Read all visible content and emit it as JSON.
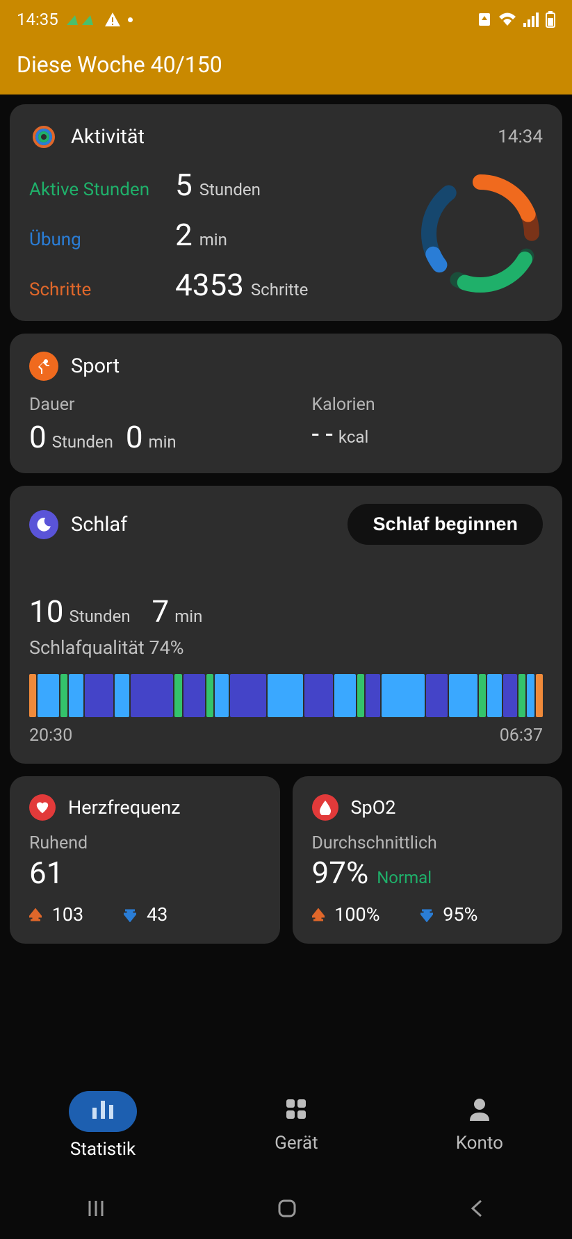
{
  "status": {
    "time": "14:35"
  },
  "header": {
    "title": "Diese Woche 40/150"
  },
  "activity": {
    "title": "Aktivität",
    "timestamp": "14:34",
    "active_hours": {
      "label": "Aktive Stunden",
      "value": "5",
      "unit": "Stunden"
    },
    "exercise": {
      "label": "Übung",
      "value": "2",
      "unit": "min"
    },
    "steps": {
      "label": "Schritte",
      "value": "4353",
      "unit": "Schritte"
    }
  },
  "sport": {
    "title": "Sport",
    "dauer_label": "Dauer",
    "dauer_h": "0",
    "dauer_h_unit": "Stunden",
    "dauer_m": "0",
    "dauer_m_unit": "min",
    "kalorien_label": "Kalorien",
    "kcal_value": "- -",
    "kcal_unit": "kcal"
  },
  "sleep": {
    "title": "Schlaf",
    "start_button": "Schlaf beginnen",
    "hours": "10",
    "hours_unit": "Stunden",
    "minutes": "7",
    "minutes_unit": "min",
    "quality": "Schlafqualität 74%",
    "start_time": "20:30",
    "end_time": "06:37"
  },
  "heart": {
    "title": "Herzfrequenz",
    "state_label": "Ruhend",
    "value": "61",
    "high": "103",
    "low": "43"
  },
  "spo2": {
    "title": "SpO2",
    "state_label": "Durchschnittlich",
    "value": "97%",
    "status": "Normal",
    "high": "100%",
    "low": "95%"
  },
  "nav": {
    "stat": "Statistik",
    "device": "Gerät",
    "account": "Konto"
  }
}
